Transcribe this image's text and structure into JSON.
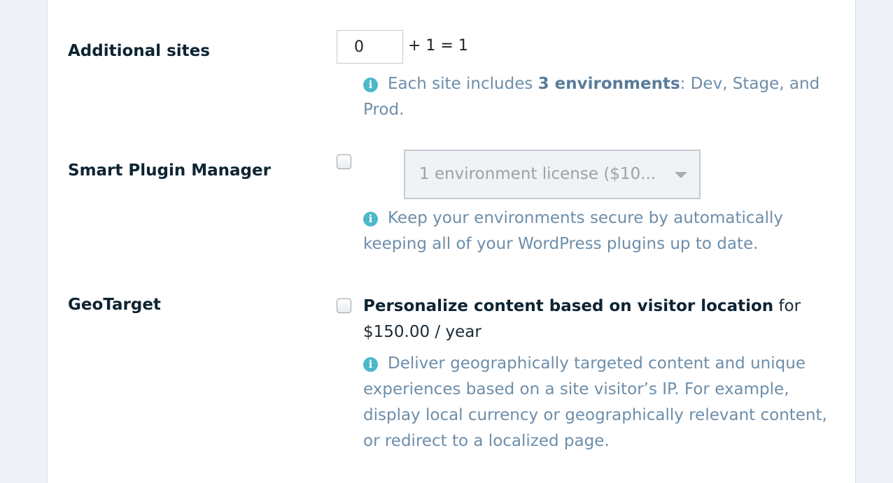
{
  "additional_sites": {
    "label": "Additional sites",
    "value": "0",
    "calc_text": "+ 1 = 1",
    "note_prefix": "Each site includes ",
    "note_bold": "3 environments",
    "note_suffix": ": Dev, Stage, and Prod."
  },
  "smart_plugin_manager": {
    "label": "Smart Plugin Manager",
    "checked": false,
    "select_value": "1 environment license ($10...",
    "note": "Keep your environments secure by automatically keeping all of your WordPress plugins up to date."
  },
  "geotarget": {
    "label": "GeoTarget",
    "checked": false,
    "offer_bold": "Personalize content based on visitor location",
    "offer_suffix": " for $150.00 / year",
    "note": "Deliver geographically targeted content and unique experiences based on a site visitor’s IP. For example, display local currency or geographically relevant content, or redirect to a localized page."
  },
  "icons": {
    "info": "info-icon",
    "dropdown": "chevron-down-icon"
  },
  "colors": {
    "info_icon": "#4db8c9",
    "note_text": "#6d8eaa",
    "label_text": "#0e2433"
  }
}
